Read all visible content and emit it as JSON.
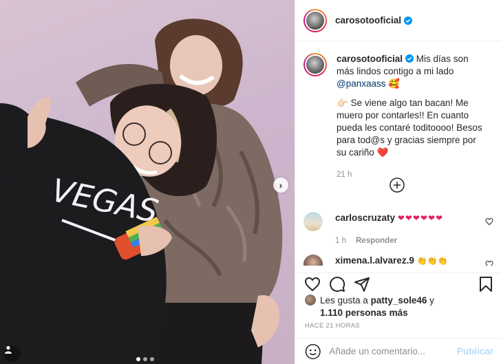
{
  "post": {
    "username": "carosotooficial",
    "caption": {
      "line1": "Mis días son más lindos contigo a mi lado",
      "mention": "@panxaass",
      "emoji1": "🥰",
      "para2_emoji": "👉🏻",
      "para2": "Se viene algo tan bacan! Me muero por contarles!! En cuanto pueda les contaré toditoooo! Besos para tod@s y gracias siempre por su cariño",
      "para2_end_emoji": "❤️",
      "time": "21 h"
    },
    "photo": {
      "shirt_text": "VEGAS",
      "carousel_position": "1 of 3"
    }
  },
  "comments": [
    {
      "username": "carloscruzaty",
      "text": "❤❤❤❤❤❤",
      "time": "1 h",
      "reply": "Responder"
    },
    {
      "username": "ximena.l.alvarez.9",
      "text": "👏👏👏"
    }
  ],
  "likes": {
    "prefix": "Les gusta a",
    "user": "patty_sole46",
    "and": "y",
    "others": "1.110 personas más"
  },
  "posted_time": "HACE 21 HORAS",
  "add_comment": {
    "placeholder": "Añade un comentario...",
    "publish": "Publicar"
  },
  "colors": {
    "link": "#00376b",
    "verified": "#0095f6",
    "publish_disabled": "#b2dffc",
    "heart": "#ed4956"
  }
}
